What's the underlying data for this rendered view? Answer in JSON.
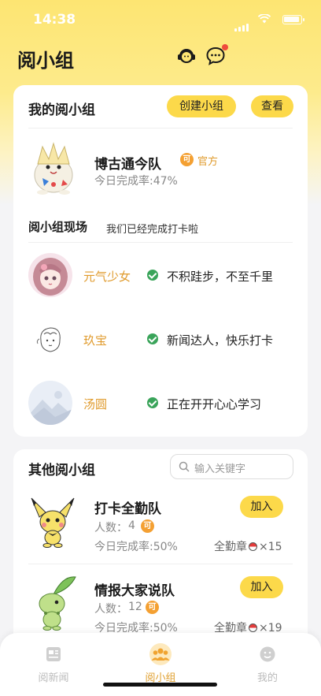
{
  "status": {
    "time": "14:38"
  },
  "header": {
    "title": "阅小组",
    "icons": [
      "customer-service-icon",
      "message-icon"
    ]
  },
  "my_group": {
    "title": "我的阅小组",
    "create_label": "创建小组",
    "view_label": "查看",
    "team": {
      "name": "博古通今队",
      "badge": "可",
      "official": "官方",
      "completion": "今日完成率:47%"
    }
  },
  "scene": {
    "title": "阅小组现场",
    "subtitle": "我们已经完成打卡啦",
    "items": [
      {
        "user": "元气少女",
        "message": "不积跬步，不至千里"
      },
      {
        "user": "玖宝",
        "message": "新闻达人，快乐打卡"
      },
      {
        "user": "汤圆",
        "message": "正在开开心心学习"
      }
    ]
  },
  "other": {
    "title": "其他阅小组",
    "search_placeholder": "输入关键字",
    "teams": [
      {
        "name": "打卡全勤队",
        "members_label": "人数：",
        "members": "4",
        "badge": "可",
        "completion": "今日完成率:50%",
        "join_label": "加入",
        "medal_label": "全勤章",
        "medal_count": "×15"
      },
      {
        "name": "情报大家说队",
        "members_label": "人数：",
        "members": "12",
        "badge": "可",
        "completion": "今日完成率:50%",
        "join_label": "加入",
        "medal_label": "全勤章",
        "medal_count": "×19"
      }
    ]
  },
  "tabbar": {
    "items": [
      {
        "label": "阅新闻",
        "icon": "news-icon"
      },
      {
        "label": "阅小组",
        "icon": "group-icon",
        "active": true
      },
      {
        "label": "我的",
        "icon": "profile-icon"
      }
    ]
  },
  "colors": {
    "brand_yellow": "#fcd94a",
    "accent_orange": "#e09b2d",
    "check_green": "#3aa45a"
  }
}
